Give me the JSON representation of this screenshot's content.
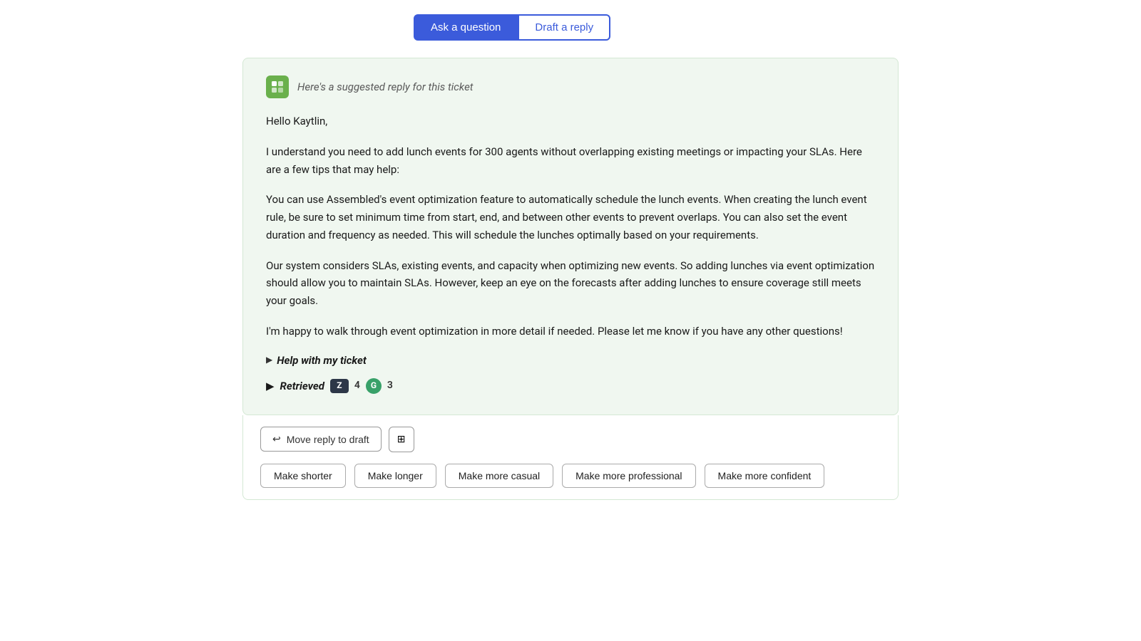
{
  "tabs": [
    {
      "id": "ask-question",
      "label": "Ask a question",
      "active": true
    },
    {
      "id": "draft-reply",
      "label": "Draft a reply",
      "active": false
    }
  ],
  "reply_card": {
    "header_text": "Here's a suggested reply for this ticket",
    "paragraphs": [
      "Hello Kaytlin,",
      "I understand you need to add lunch events for 300 agents without overlapping existing meetings or impacting your SLAs. Here are a few tips that may help:",
      "You can use Assembled's event optimization feature to automatically schedule the lunch events. When creating the lunch event rule, be sure to set minimum time from start, end, and between other events to prevent overlaps. You can also set the event duration and frequency as needed. This will schedule the lunches optimally based on your requirements.",
      "Our system considers SLAs, existing events, and capacity when optimizing new events. So adding lunches via event optimization should allow you to maintain SLAs. However, keep an eye on the forecasts after adding lunches to ensure coverage still meets your goals.",
      "I'm happy to walk through event optimization in more detail if needed. Please let me know if you have any other questions!"
    ],
    "help_section_label": "Help with my ticket",
    "retrieved_section_label": "Retrieved",
    "badge_z_label": "Z",
    "badge_z_count": "4",
    "badge_g_label": "G",
    "badge_g_count": "3"
  },
  "actions": {
    "move_draft_label": "Move reply to draft",
    "tone_buttons": [
      {
        "id": "make-shorter",
        "label": "Make shorter"
      },
      {
        "id": "make-longer",
        "label": "Make longer"
      },
      {
        "id": "make-casual",
        "label": "Make more casual"
      },
      {
        "id": "make-professional",
        "label": "Make more professional"
      },
      {
        "id": "make-confident",
        "label": "Make more confident"
      }
    ]
  }
}
